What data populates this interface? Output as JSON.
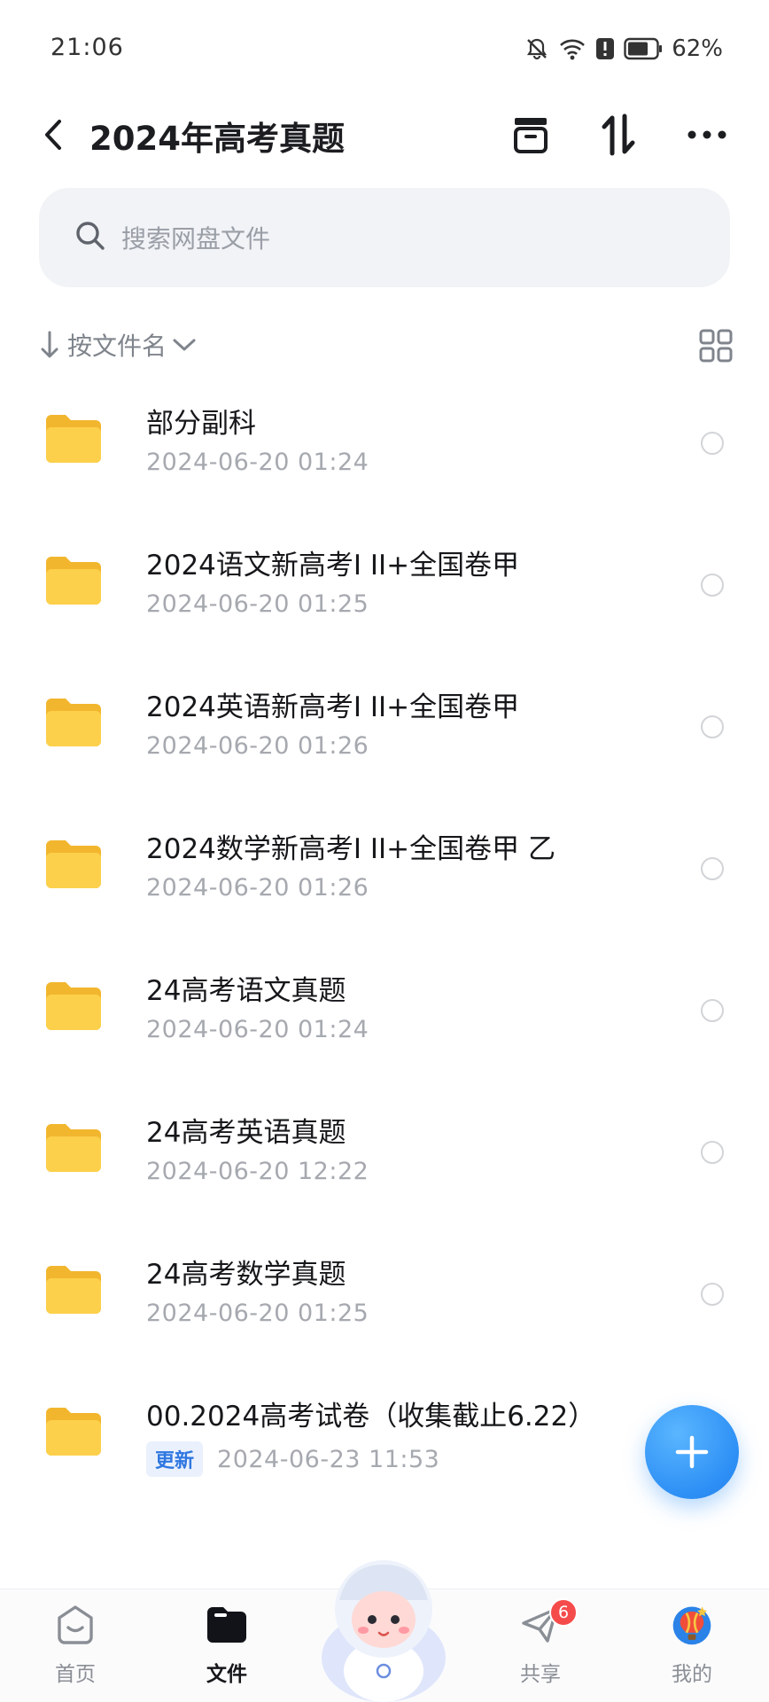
{
  "status_bar": {
    "time": "21:06",
    "battery": "62%"
  },
  "header": {
    "title": "2024年高考真题",
    "back_icon": "back-arrow-icon",
    "icons": [
      "archive-icon",
      "sort-swap-icon",
      "more-icon"
    ]
  },
  "search": {
    "placeholder": "搜索网盘文件"
  },
  "sort": {
    "label": "按文件名"
  },
  "files": [
    {
      "name": "部分副科",
      "date": "2024-06-20  01:24"
    },
    {
      "name": "2024语文新高考I II+全国卷甲",
      "date": "2024-06-20  01:25"
    },
    {
      "name": "2024英语新高考I II+全国卷甲",
      "date": "2024-06-20  01:26"
    },
    {
      "name": "2024数学新高考I II+全国卷甲 乙",
      "date": "2024-06-20  01:26"
    },
    {
      "name": "24高考语文真题",
      "date": "2024-06-20  01:24"
    },
    {
      "name": "24高考英语真题",
      "date": "2024-06-20  12:22"
    },
    {
      "name": "24高考数学真题",
      "date": "2024-06-20  01:25"
    },
    {
      "name": "00.2024高考试卷（收集截止6.22）",
      "date": "2024-06-23  11:53",
      "badge": "更新"
    }
  ],
  "nav": {
    "home": "首页",
    "files": "文件",
    "share": "共享",
    "share_badge": "6",
    "mine": "我的"
  },
  "colors": {
    "accent": "#2d8ff5",
    "folder": "#f9c940",
    "badge": "#f54b4b"
  }
}
